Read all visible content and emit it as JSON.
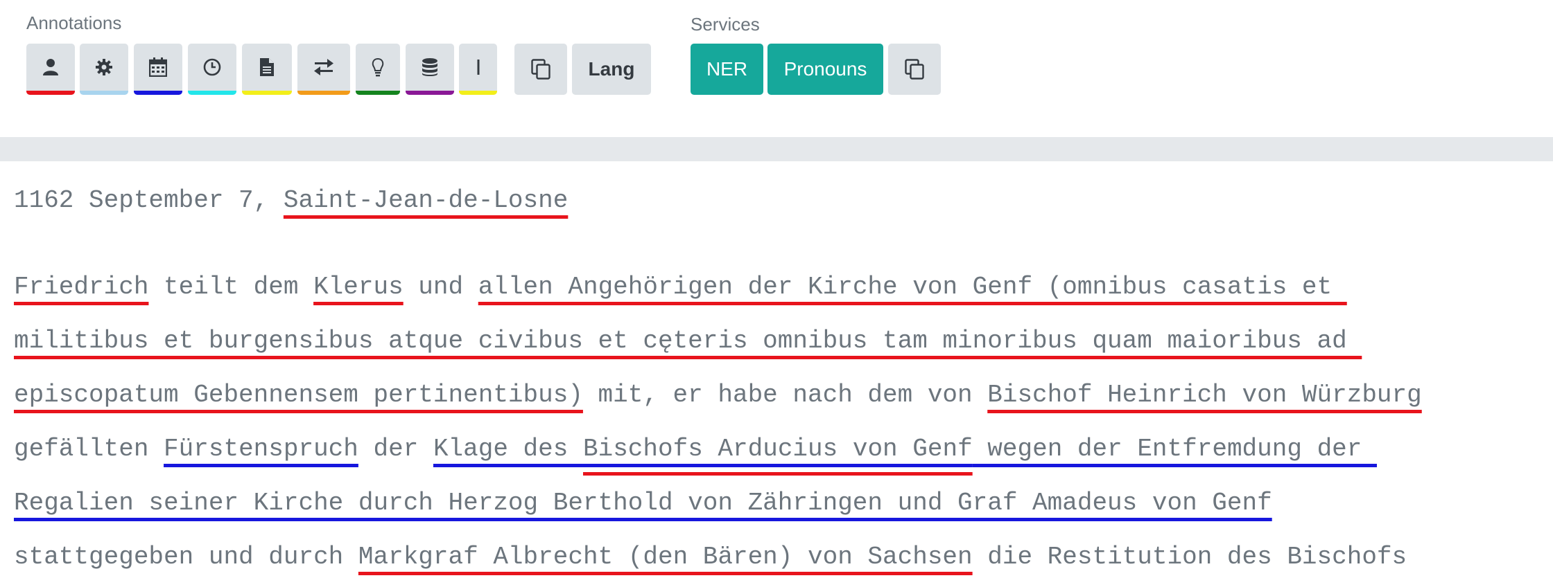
{
  "annotations": {
    "label": "Annotations",
    "buttons": [
      {
        "icon": "person-icon",
        "color": "#e8141c"
      },
      {
        "icon": "gear-icon",
        "color": "#a8d4ee"
      },
      {
        "icon": "calendar-icon",
        "color": "#1717dd"
      },
      {
        "icon": "clock-icon",
        "color": "#22e6ea"
      },
      {
        "icon": "document-icon",
        "color": "#f2ee1a"
      },
      {
        "icon": "arrows-exchange-icon",
        "color": "#f29b1a"
      },
      {
        "icon": "lightbulb-icon",
        "color": "#14841e"
      },
      {
        "icon": "database-icon",
        "color": "#8a1896"
      },
      {
        "icon": "text-cursor-icon",
        "color": "#f2ee1a"
      }
    ],
    "copy_icon": "copy-icon",
    "lang_label": "Lang"
  },
  "services": {
    "label": "Services",
    "ner_label": "NER",
    "pronouns_label": "Pronouns",
    "copy_icon": "copy-icon"
  },
  "document": {
    "heading_plain": "1162 September 7, ",
    "heading_place": "Saint-Jean-de-Losne",
    "lines": {
      "l1_a": "Friedrich",
      "l1_b": " teilt dem ",
      "l1_c": "Klerus",
      "l1_d": " und ",
      "l1_e": "allen Angehörigen der Kirche von Genf (omnibus casatis et ",
      "l2_a": "militibus et burgensibus atque civibus et cęteris omnibus tam minoribus quam maioribus ad ",
      "l3_a": "episcopatum Gebennensem pertinentibus)",
      "l3_b": " mit, er habe nach dem von ",
      "l3_c": "Bischof Heinrich von Würzburg",
      "l4_a": "gefällten ",
      "l4_b": "Fürstenspruch",
      "l4_c": " der ",
      "l4_d": "Klage des ",
      "l4_e": "Bischofs Arducius von Genf",
      "l4_f": " wegen der Entfremdung der ",
      "l5_a": "Regalien seiner Kirche durch Herzog Berthold von Zähringen und Graf Amadeus von Genf",
      "l6_a": "stattgegeben und durch ",
      "l6_b": "Markgraf Albrecht (den Bären) von Sachsen",
      "l6_c": " die Restitution des Bischofs"
    }
  },
  "colors": {
    "teal": "#16a89b",
    "button_gray": "#dde2e6",
    "red_underline": "#e8141c",
    "blue_underline": "#1717dd"
  }
}
